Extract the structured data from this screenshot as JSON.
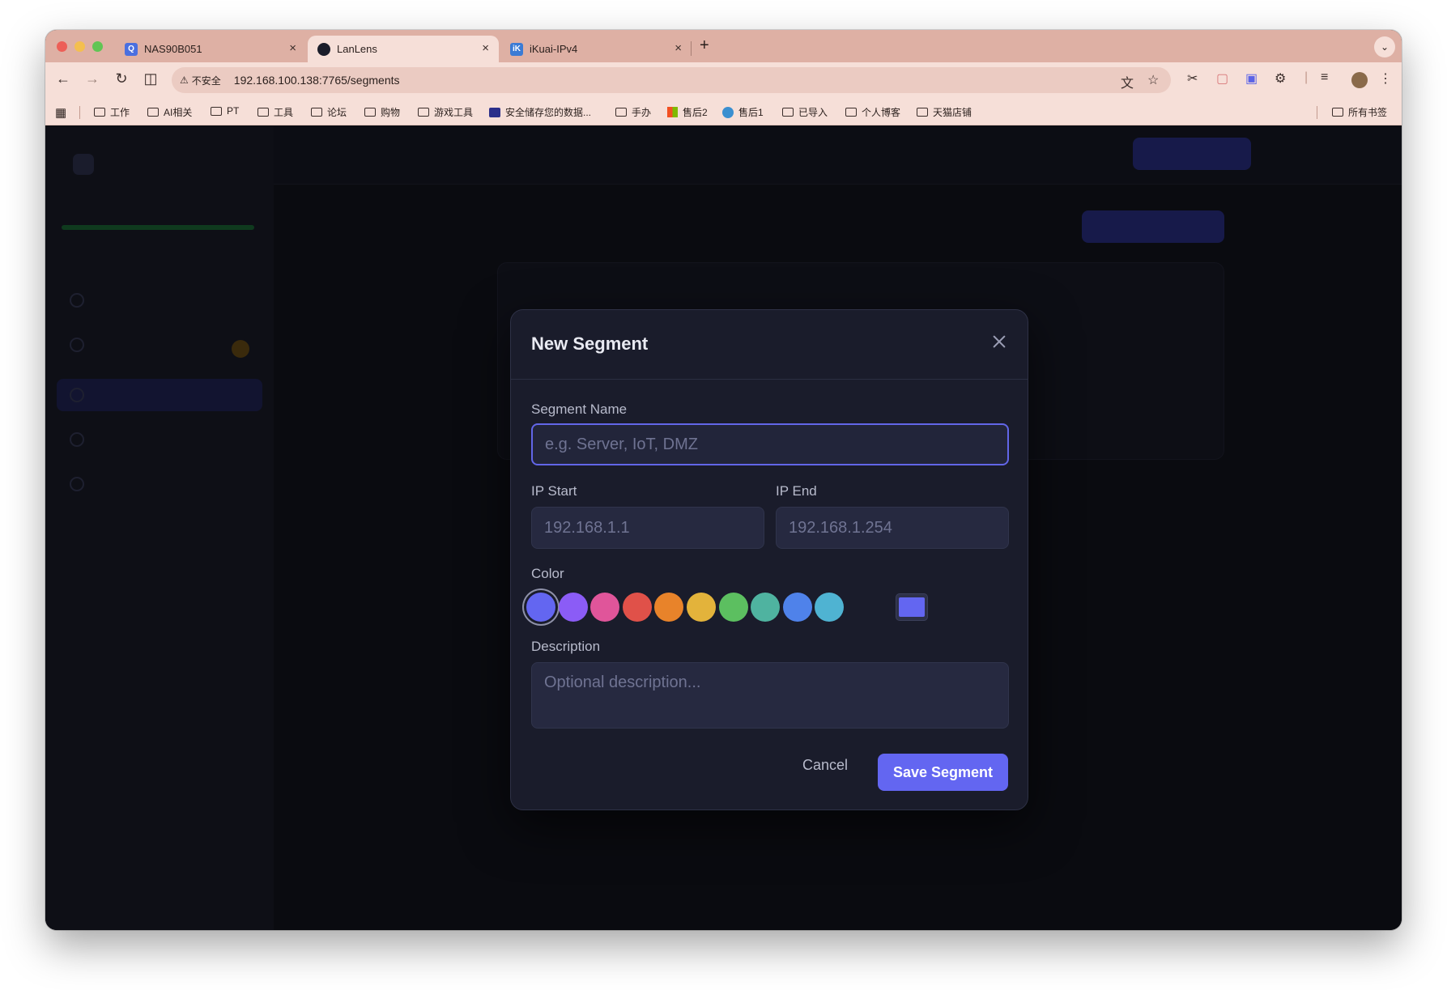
{
  "browser": {
    "tabs": [
      {
        "title": "NAS90B051",
        "favicon_color": "#4a6fe0"
      },
      {
        "title": "LanLens",
        "favicon_color": "#1b1d2a"
      },
      {
        "title": "iKuai-IPv4",
        "favicon_color": "#3a7bd5"
      }
    ],
    "tab_close_glyph": "×",
    "new_tab_glyph": "+",
    "insecure_label": "不安全",
    "url": "192.168.100.138:7765/segments",
    "bookmarks": [
      "工作",
      "AI相关",
      "PT",
      "工具",
      "论坛",
      "购物",
      "游戏工具",
      "安全储存您的数据...",
      "手办",
      "售后2",
      "售后1",
      "已导入",
      "个人博客",
      "天猫店铺"
    ],
    "all_bookmarks": "所有书签"
  },
  "modal": {
    "title": "New Segment",
    "name_label": "Segment Name",
    "name_placeholder": "e.g. Server, IoT, DMZ",
    "ip_start_label": "IP Start",
    "ip_start_placeholder": "192.168.1.1",
    "ip_end_label": "IP End",
    "ip_end_placeholder": "192.168.1.254",
    "color_label": "Color",
    "colors": [
      "#6366f1",
      "#8b5cf6",
      "#e0559a",
      "#e05149",
      "#e8832a",
      "#e3b33b",
      "#5cbf60",
      "#4fb3a0",
      "#4f82ea",
      "#4fb3d2"
    ],
    "selected_color": "#6366f1",
    "description_label": "Description",
    "description_placeholder": "Optional description...",
    "cancel_label": "Cancel",
    "save_label": "Save Segment"
  }
}
